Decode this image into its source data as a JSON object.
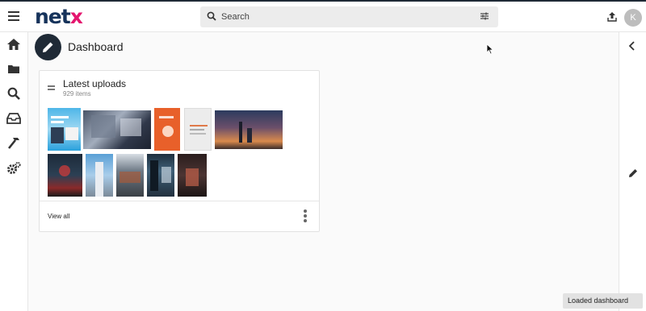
{
  "app": {
    "logo_part1": "net",
    "logo_part2": "x"
  },
  "search": {
    "placeholder": "Search"
  },
  "user": {
    "initial": "K"
  },
  "page": {
    "title": "Dashboard"
  },
  "card": {
    "title": "Latest uploads",
    "subtitle": "929 items",
    "view_all": "View all"
  },
  "toast": {
    "text": "Loaded dashboard"
  },
  "colors": {
    "brand_navy": "#16335b",
    "brand_pink": "#e4156e",
    "fab": "#1f2a36"
  },
  "icons": {
    "nav": [
      "home-icon",
      "folder-icon",
      "search-icon",
      "inbox-icon",
      "hammer-icon",
      "settings-icon"
    ],
    "right": [
      "chevron-left-icon",
      "pencil-icon"
    ]
  }
}
